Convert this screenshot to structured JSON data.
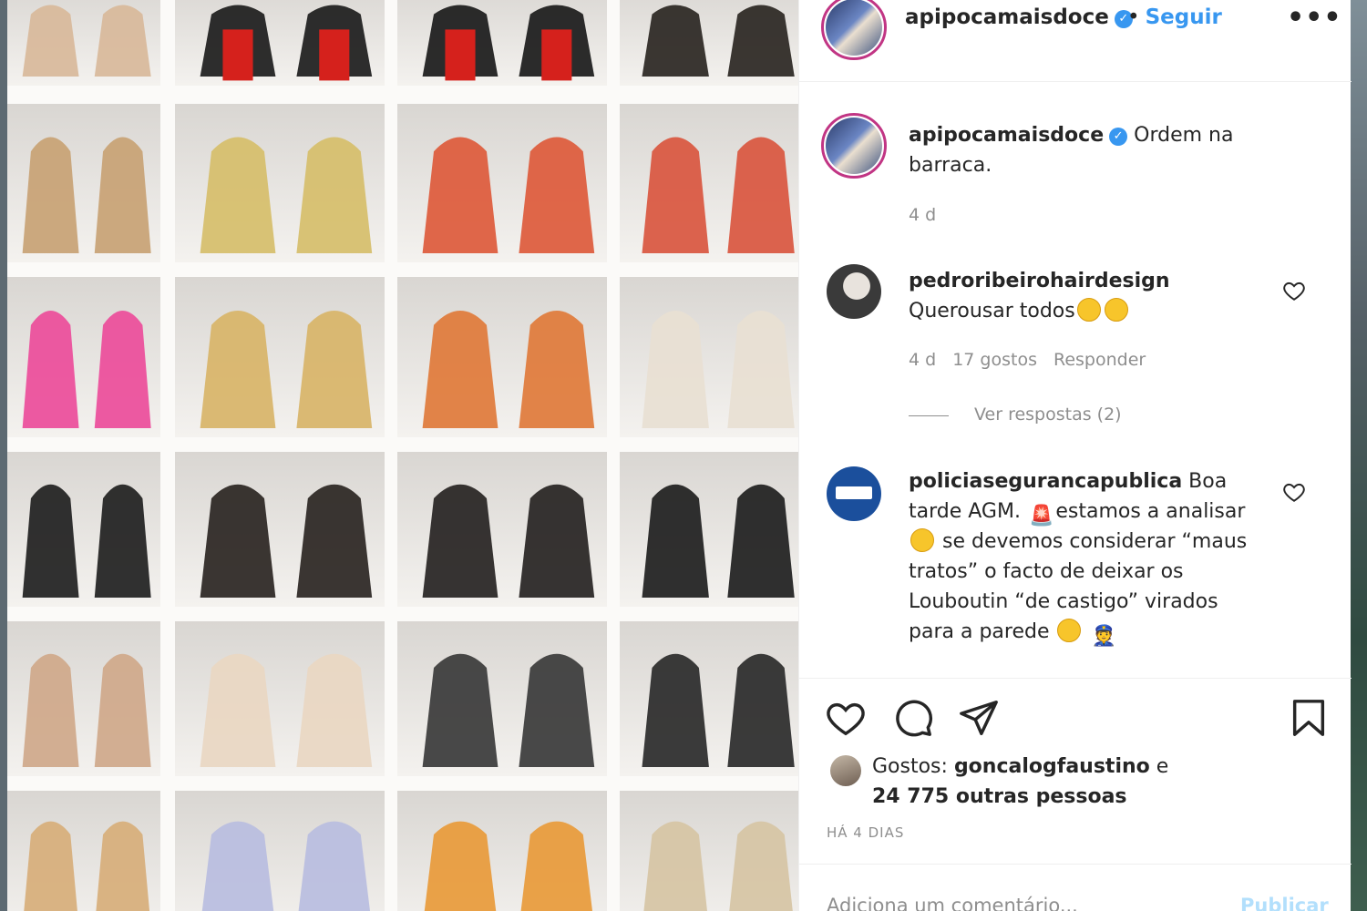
{
  "post": {
    "author": "apipocamaisdoce",
    "follow_label": "Seguir",
    "more_label": "•••",
    "caption_username": "apipocamaisdoce",
    "caption_text": "Ordem na barraca.",
    "caption_time": "4 d"
  },
  "comments": [
    {
      "username": "pedroribeirohairdesign",
      "text": "Querousar todos",
      "time": "4 d",
      "likes": "17 gostos",
      "reply_label": "Responder",
      "view_replies": "Ver respostas (2)"
    },
    {
      "username": "policiasegurancapublica",
      "text_1": "Boa tarde AGM.",
      "text_2": "estamos a analisar",
      "text_3": "se devemos considerar “maus tratos” o facto de deixar os Louboutin “de castigo” virados para a parede"
    }
  ],
  "likes": {
    "prefix": "Gostos:",
    "user": "goncalogfaustino",
    "conj": "e",
    "others": "24 775 outras pessoas"
  },
  "timestamp": "HÁ 4 DIAS",
  "comment_box": {
    "placeholder": "Adiciona um comentário...",
    "publish_label": "Publicar"
  },
  "icons": {
    "like": "heart-icon",
    "comment": "comment-icon",
    "share": "share-icon",
    "save": "bookmark-icon"
  },
  "colors": {
    "link_blue": "#3897f0",
    "verified": "#3897f0",
    "text": "#262626",
    "muted": "#8e8e8e"
  }
}
